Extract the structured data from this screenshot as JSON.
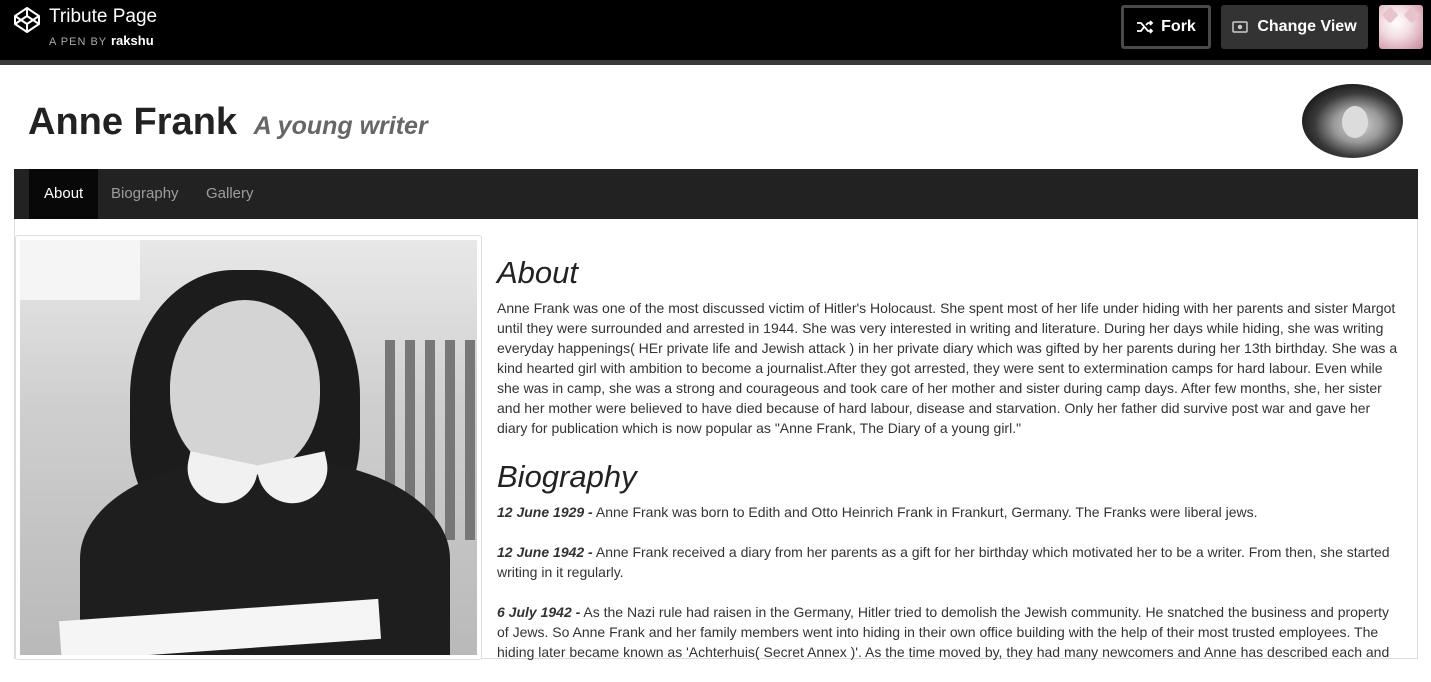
{
  "codepen": {
    "title": "Tribute Page",
    "by_label": "A PEN BY",
    "author": "rakshu",
    "fork_label": "Fork",
    "change_view_label": "Change View",
    "icons": [
      "codepen-logo-icon",
      "fork-icon",
      "eye-icon"
    ]
  },
  "header": {
    "title": "Anne Frank",
    "subtitle": "A young writer"
  },
  "nav": {
    "items": [
      {
        "label": "About",
        "active": true
      },
      {
        "label": "Biography",
        "active": false
      },
      {
        "label": "Gallery",
        "active": false
      }
    ]
  },
  "about": {
    "heading": "About",
    "text": "Anne Frank was one of the most discussed victim of Hitler's Holocaust. She spent most of her life under hiding with her parents and sister Margot until they were surrounded and arrested in 1944. She was very interested in writing and literature. During her days while hiding, she was writing everyday happenings( HEr private life and Jewish attack ) in her private diary which was gifted by her parents during her 13th birthday. She was a kind hearted girl with ambition to become a journalist.After they got arrested, they were sent to extermination camps for hard labour. Even while she was in camp, she was a strong and courageous and took care of her mother and sister during camp days. After few months, she, her sister and her mother were believed to have died because of hard labour, disease and starvation. Only her father did survive post war and gave her diary for publication which is now popular as \"Anne Frank, The Diary of a young girl.\""
  },
  "biography": {
    "heading": "Biography",
    "entries": [
      {
        "date": "12 June 1929 -",
        "text": " Anne Frank was born to Edith and Otto Heinrich Frank in Frankurt, Germany. The Franks were liberal jews."
      },
      {
        "date": "12 June 1942 -",
        "text": " Anne Frank received a diary from her parents as a gift for her birthday which motivated her to be a writer. From then, she started writing in it regularly."
      },
      {
        "date": "6 July 1942 -",
        "text": " As the Nazi rule had raisen in the Germany, Hitler tried to demolish the Jewish community. He snatched the business and property of Jews. So Anne Frank and her family members went into hiding in their own office building with the help of their most trusted employees. The hiding later became known as 'Achterhuis( Secret Annex )'. As the time moved by, they had many newcomers and Anne has described each and"
      }
    ]
  }
}
